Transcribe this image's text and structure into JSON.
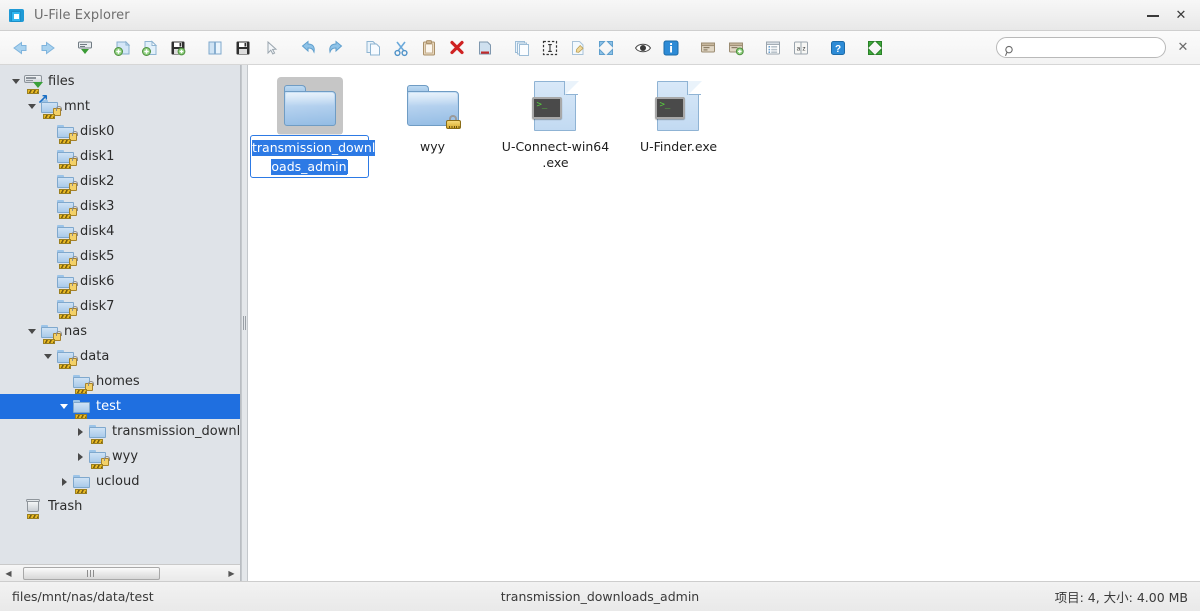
{
  "window": {
    "title": "U-File Explorer",
    "icon": "app-folder-icon",
    "minimize_label": "−",
    "close_label": "✕"
  },
  "toolbar": {
    "groups": [
      {
        "name": "navigation",
        "buttons": [
          {
            "name": "back-button",
            "icon": "arrow-left-icon",
            "label": "Back"
          },
          {
            "name": "forward-button",
            "icon": "arrow-right-icon",
            "label": "Forward"
          }
        ]
      },
      {
        "name": "connection",
        "buttons": [
          {
            "name": "mount-button",
            "icon": "server-download-icon",
            "label": "Mount"
          }
        ]
      },
      {
        "name": "create",
        "buttons": [
          {
            "name": "new-folder-button",
            "icon": "folder-add-icon",
            "label": "New Folder"
          },
          {
            "name": "new-file-button",
            "icon": "file-add-icon",
            "label": "New File"
          },
          {
            "name": "save-button",
            "icon": "floppy-add-icon",
            "label": "Save"
          }
        ]
      },
      {
        "name": "open-save",
        "buttons": [
          {
            "name": "open-button",
            "icon": "open-book-icon",
            "label": "Open"
          },
          {
            "name": "save-as-button",
            "icon": "floppy-icon",
            "label": "Save As"
          },
          {
            "name": "select-pointer-button",
            "icon": "cursor-arrow-icon",
            "label": "Select"
          }
        ]
      },
      {
        "name": "history",
        "buttons": [
          {
            "name": "undo-button",
            "icon": "undo-icon",
            "label": "Undo"
          },
          {
            "name": "redo-button",
            "icon": "redo-icon",
            "label": "Redo"
          }
        ]
      },
      {
        "name": "clipboard",
        "buttons": [
          {
            "name": "copy-button",
            "icon": "copy-icon",
            "label": "Copy"
          },
          {
            "name": "cut-button",
            "icon": "scissors-icon",
            "label": "Cut"
          },
          {
            "name": "paste-button",
            "icon": "clipboard-icon",
            "label": "Paste"
          },
          {
            "name": "delete-button",
            "icon": "red-x-icon",
            "label": "Delete"
          },
          {
            "name": "eject-button",
            "icon": "drive-remove-icon",
            "label": "Eject"
          }
        ]
      },
      {
        "name": "edit",
        "buttons": [
          {
            "name": "duplicate-button",
            "icon": "stack-copy-icon",
            "label": "Duplicate"
          },
          {
            "name": "select-all-button",
            "icon": "selection-marquee-icon",
            "label": "Select All"
          },
          {
            "name": "rename-button",
            "icon": "pencil-file-icon",
            "label": "Rename"
          },
          {
            "name": "expand-selection-button",
            "icon": "expand-arrows-icon",
            "label": "Expand"
          }
        ]
      },
      {
        "name": "view",
        "buttons": [
          {
            "name": "preview-button",
            "icon": "eye-icon",
            "label": "Preview"
          },
          {
            "name": "info-button",
            "icon": "info-icon",
            "label": "Properties"
          }
        ]
      },
      {
        "name": "archive",
        "buttons": [
          {
            "name": "extract-archive-button",
            "icon": "archive-icon",
            "label": "Extract"
          },
          {
            "name": "create-archive-button",
            "icon": "archive-add-icon",
            "label": "Compress"
          }
        ]
      },
      {
        "name": "list",
        "buttons": [
          {
            "name": "list-view-button",
            "icon": "list-icon",
            "label": "List View"
          },
          {
            "name": "sort-button",
            "icon": "sort-az-icon",
            "label": "Sort"
          }
        ]
      },
      {
        "name": "help",
        "buttons": [
          {
            "name": "help-button",
            "icon": "question-mark-icon",
            "label": "Help"
          }
        ]
      },
      {
        "name": "fullscreen",
        "buttons": [
          {
            "name": "fullscreen-button",
            "icon": "fullscreen-arrows-icon",
            "label": "Full Screen"
          }
        ]
      }
    ],
    "search": {
      "value": "",
      "placeholder": "",
      "icon": "search-icon"
    },
    "close_search_label": "✕"
  },
  "sidebar": {
    "tree": [
      {
        "label": "files",
        "indent": 0,
        "expander": "down",
        "icon": "drive-files-icon",
        "selected": false
      },
      {
        "label": "mnt",
        "indent": 1,
        "expander": "down",
        "icon": "folder-shortcut-lock-icon",
        "selected": false
      },
      {
        "label": "disk0",
        "indent": 2,
        "expander": "none",
        "icon": "folder-lock-icon",
        "selected": false
      },
      {
        "label": "disk1",
        "indent": 2,
        "expander": "none",
        "icon": "folder-lock-icon",
        "selected": false
      },
      {
        "label": "disk2",
        "indent": 2,
        "expander": "none",
        "icon": "folder-lock-icon",
        "selected": false
      },
      {
        "label": "disk3",
        "indent": 2,
        "expander": "none",
        "icon": "folder-lock-icon",
        "selected": false
      },
      {
        "label": "disk4",
        "indent": 2,
        "expander": "none",
        "icon": "folder-lock-icon",
        "selected": false
      },
      {
        "label": "disk5",
        "indent": 2,
        "expander": "none",
        "icon": "folder-lock-icon",
        "selected": false
      },
      {
        "label": "disk6",
        "indent": 2,
        "expander": "none",
        "icon": "folder-lock-icon",
        "selected": false
      },
      {
        "label": "disk7",
        "indent": 2,
        "expander": "none",
        "icon": "folder-lock-icon",
        "selected": false
      },
      {
        "label": "nas",
        "indent": 1,
        "expander": "down",
        "icon": "folder-lock-icon",
        "selected": false
      },
      {
        "label": "data",
        "indent": 2,
        "expander": "down",
        "icon": "folder-lock-icon",
        "selected": false
      },
      {
        "label": "homes",
        "indent": 3,
        "expander": "none",
        "icon": "folder-lock-icon",
        "selected": false
      },
      {
        "label": "test",
        "indent": 3,
        "expander": "down",
        "icon": "folder-icon",
        "selected": true
      },
      {
        "label": "transmission_downloa",
        "indent": 4,
        "expander": "right",
        "icon": "folder-icon",
        "selected": false
      },
      {
        "label": "wyy",
        "indent": 4,
        "expander": "right",
        "icon": "folder-lock-icon",
        "selected": false
      },
      {
        "label": "ucloud",
        "indent": 3,
        "expander": "right",
        "icon": "folder-icon",
        "selected": false
      },
      {
        "label": "Trash",
        "indent": 0,
        "expander": "none",
        "icon": "trash-icon",
        "selected": false
      }
    ],
    "hscroll": {
      "left_arrow": "◀",
      "right_arrow": "▶",
      "name": "sidebar-horizontal-scrollbar"
    }
  },
  "fileview": {
    "items": [
      {
        "name": "transmission_downloads_admin",
        "type": "folder",
        "icon": "folder-icon",
        "editing": true,
        "edit_line_1": "transmission_downl",
        "edit_line_2": "oads_admin"
      },
      {
        "name": "wyy",
        "type": "folder",
        "icon": "folder-lock-icon",
        "editing": false
      },
      {
        "name": "U-Connect-win64.exe",
        "type": "executable",
        "icon": "exe-terminal-icon",
        "editing": false,
        "caption_line_1": "U-Connect-win64",
        "caption_line_2": ".exe"
      },
      {
        "name": "U-Finder.exe",
        "type": "executable",
        "icon": "exe-terminal-icon",
        "editing": false,
        "caption_line_1": "U-Finder.exe",
        "caption_line_2": ""
      }
    ]
  },
  "statusbar": {
    "path": "files/mnt/nas/data/test",
    "selection": "transmission_downloads_admin",
    "summary": "项目: 4, 大小: 4.00 MB"
  },
  "colors": {
    "selection_blue": "#1f6fe0",
    "edit_highlight": "#2d7ae5",
    "sidebar_bg": "#dfe3e8",
    "title_text": "#6e6e6e"
  }
}
